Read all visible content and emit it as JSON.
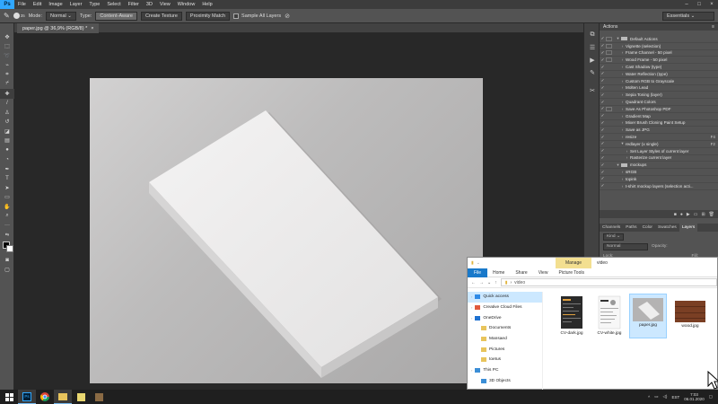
{
  "app": {
    "logo_text": "Ps",
    "menu": [
      "File",
      "Edit",
      "Image",
      "Layer",
      "Type",
      "Select",
      "Filter",
      "3D",
      "View",
      "Window",
      "Help"
    ],
    "window_controls": {
      "minimize": "–",
      "maximize": "□",
      "close": "×"
    }
  },
  "options_bar": {
    "brush_size": "35",
    "mode_label": "Mode:",
    "mode_value": "Normal",
    "type_label": "Type:",
    "type_options": [
      "Content-Aware",
      "Create Texture",
      "Proximity Match"
    ],
    "type_selected": "Content-Aware",
    "sample_all_layers": "Sample All Layers",
    "workspace": "Essentials"
  },
  "document_tab": {
    "title": "paper.jpg @ 36,9% (RGB/8) *",
    "close": "×"
  },
  "actions_panel": {
    "title": "Actions",
    "rows": [
      {
        "label": "Default Actions",
        "check": "✓",
        "box": true,
        "kind": "folder",
        "tri": "▾",
        "key": ""
      },
      {
        "label": "Vignette (selection)",
        "check": "✓",
        "box": true,
        "kind": "action",
        "tri": "›",
        "key": ""
      },
      {
        "label": "Frame Channel - 50 pixel",
        "check": "✓",
        "box": true,
        "kind": "action",
        "tri": "›",
        "key": ""
      },
      {
        "label": "Wood Frame - 50 pixel",
        "check": "✓",
        "box": true,
        "kind": "action",
        "tri": "›",
        "key": ""
      },
      {
        "label": "Cast Shadow (type)",
        "check": "✓",
        "box": false,
        "kind": "action",
        "tri": "›",
        "key": ""
      },
      {
        "label": "Water Reflection (type)",
        "check": "✓",
        "box": false,
        "kind": "action",
        "tri": "›",
        "key": ""
      },
      {
        "label": "Custom RGB to Grayscale",
        "check": "✓",
        "box": false,
        "kind": "action",
        "tri": "›",
        "key": ""
      },
      {
        "label": "Molten Lead",
        "check": "✓",
        "box": false,
        "kind": "action",
        "tri": "›",
        "key": ""
      },
      {
        "label": "Sepia Toning (layer)",
        "check": "✓",
        "box": false,
        "kind": "action",
        "tri": "›",
        "key": ""
      },
      {
        "label": "Quadrant Colors",
        "check": "✓",
        "box": false,
        "kind": "action",
        "tri": "›",
        "key": ""
      },
      {
        "label": "Save As Photoshop PDF",
        "check": "✓",
        "box": true,
        "kind": "action",
        "tri": "›",
        "key": ""
      },
      {
        "label": "Gradient Map",
        "check": "✓",
        "box": false,
        "kind": "action",
        "tri": "›",
        "key": ""
      },
      {
        "label": "Mixer Brush Cloning Paint Setup",
        "check": "✓",
        "box": false,
        "kind": "action",
        "tri": "›",
        "key": ""
      },
      {
        "label": "Save as JPG",
        "check": "✓",
        "box": false,
        "kind": "action",
        "tri": "›",
        "key": ""
      },
      {
        "label": "resize",
        "check": "✓",
        "box": false,
        "kind": "action",
        "tri": "›",
        "key": "F4"
      },
      {
        "label": "redlayer (x single)",
        "check": "✓",
        "box": false,
        "kind": "action",
        "tri": "▾",
        "key": "F2"
      },
      {
        "label": "Set Layer Styles of current layer",
        "check": "✓",
        "box": false,
        "kind": "step",
        "tri": "›",
        "key": ""
      },
      {
        "label": "Rasterize current layer",
        "check": "✓",
        "box": false,
        "kind": "step",
        "tri": "›",
        "key": ""
      },
      {
        "label": "mockups",
        "check": "✓",
        "box": false,
        "kind": "folder",
        "tri": "▾",
        "key": ""
      },
      {
        "label": "sRGB",
        "check": "✓",
        "box": false,
        "kind": "action",
        "tri": "›",
        "key": ""
      },
      {
        "label": "topink",
        "check": "✓",
        "box": false,
        "kind": "action",
        "tri": "›",
        "key": ""
      },
      {
        "label": "t-shirt mockup layers (selection acti...",
        "check": "✓",
        "box": false,
        "kind": "action",
        "tri": "›",
        "key": ""
      }
    ]
  },
  "layers_panel": {
    "tabs": [
      "Channels",
      "Paths",
      "Color",
      "Swatches",
      "Layers"
    ],
    "active_tab": "Layers",
    "kind_label": "Kind",
    "blend_mode": "Normal",
    "opacity_label": "Opacity:",
    "lock_label": "Lock:",
    "fill_label": "Fill:"
  },
  "explorer": {
    "title": "video",
    "manage_tab": "Manage",
    "ribbon_tabs": [
      "File",
      "Home",
      "Share",
      "View",
      "Picture Tools"
    ],
    "path": "video",
    "nav_items": [
      {
        "label": "Quick access",
        "icon": "star-icon",
        "color": "#2f8ae6",
        "indent": 0,
        "selected": true
      },
      {
        "label": "Creative Cloud Files",
        "icon": "cloud-icon",
        "color": "#e05a3d",
        "indent": 0,
        "selected": false
      },
      {
        "label": "OneDrive",
        "icon": "cloud-icon",
        "color": "#1f72d1",
        "indent": 0,
        "selected": false
      },
      {
        "label": "Documents",
        "icon": "folder-icon",
        "color": "#e8c45c",
        "indent": 1,
        "selected": false
      },
      {
        "label": "Mansaed",
        "icon": "folder-icon",
        "color": "#e8c45c",
        "indent": 1,
        "selected": false
      },
      {
        "label": "Pictures",
        "icon": "folder-icon",
        "color": "#e8c45c",
        "indent": 1,
        "selected": false
      },
      {
        "label": "toetus",
        "icon": "folder-icon",
        "color": "#e8c45c",
        "indent": 1,
        "selected": false
      },
      {
        "label": "This PC",
        "icon": "monitor-icon",
        "color": "#3b8ed6",
        "indent": 0,
        "selected": false
      },
      {
        "label": "3D Objects",
        "icon": "cube-icon",
        "color": "#3b8ed6",
        "indent": 1,
        "selected": false
      }
    ],
    "files": [
      {
        "name": "CV-dark.jpg",
        "selected": false
      },
      {
        "name": "CV-white.jpg",
        "selected": false
      },
      {
        "name": "paper.jpg",
        "selected": true
      },
      {
        "name": "wood.jpg",
        "selected": false
      }
    ]
  },
  "taskbar": {
    "language": "EST",
    "time": "7:03",
    "date": "06.01.2020"
  }
}
